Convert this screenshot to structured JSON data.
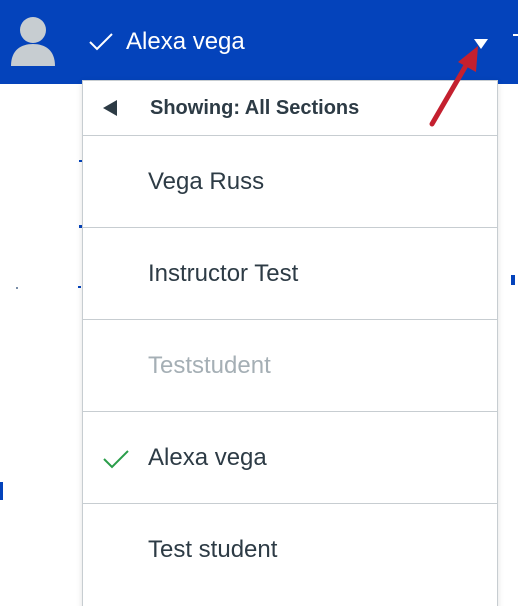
{
  "header": {
    "user_name": "Alexa vega",
    "avatar_icon": "user-avatar-icon",
    "check_icon": "checkmark-icon",
    "caret_icon": "caret-down-icon",
    "background_color": "#0443bb"
  },
  "menu": {
    "header_label": "Showing: All Sections",
    "back_icon": "back-arrow-icon",
    "items": [
      {
        "label": "Vega Russ",
        "selected": false,
        "disabled": false
      },
      {
        "label": "Instructor Test",
        "selected": false,
        "disabled": false
      },
      {
        "label": "Teststudent",
        "selected": false,
        "disabled": true
      },
      {
        "label": "Alexa vega",
        "selected": true,
        "disabled": false
      },
      {
        "label": "Test student",
        "selected": false,
        "disabled": false
      }
    ],
    "selected_check_color": "#2a9d4a",
    "disabled_text_color": "#a5afb5",
    "text_color": "#2d3b45"
  },
  "annotation": {
    "arrow_color": "#c4202f"
  }
}
